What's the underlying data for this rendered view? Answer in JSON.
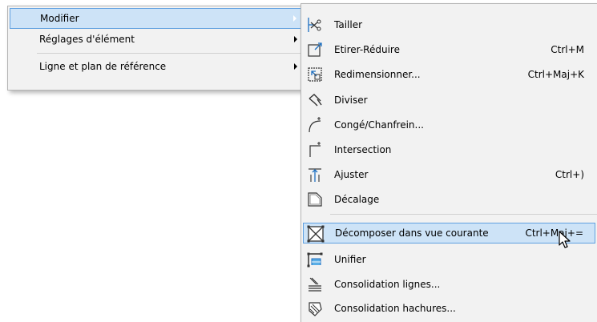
{
  "main_menu": {
    "items": [
      {
        "label": "Modifier",
        "has_submenu": true,
        "highlighted": true
      },
      {
        "label": "Réglages d'élément",
        "has_submenu": true,
        "highlighted": false
      },
      {
        "label": "Ligne et plan de référence",
        "has_submenu": true,
        "highlighted": false
      }
    ]
  },
  "sub_menu": {
    "items": [
      {
        "label": "Tailler",
        "shortcut": "",
        "icon": "trim-scissors-icon"
      },
      {
        "label": "Etirer-Réduire",
        "shortcut": "Ctrl+M",
        "icon": "stretch-icon"
      },
      {
        "label": "Redimensionner...",
        "shortcut": "Ctrl+Maj+K",
        "icon": "resize-icon"
      },
      {
        "label": "Diviser",
        "shortcut": "",
        "icon": "split-icon"
      },
      {
        "label": "Congé/Chanfrein...",
        "shortcut": "",
        "icon": "fillet-chamfer-icon"
      },
      {
        "label": "Intersection",
        "shortcut": "",
        "icon": "intersect-icon"
      },
      {
        "label": "Ajuster",
        "shortcut": "Ctrl+)",
        "icon": "adjust-icon"
      },
      {
        "label": "Décalage",
        "shortcut": "",
        "icon": "offset-icon"
      },
      {
        "label": "Décomposer dans vue courante",
        "shortcut": "Ctrl+Maj+=",
        "icon": "explode-icon",
        "highlighted": true
      },
      {
        "label": "Unifier",
        "shortcut": "",
        "icon": "unify-icon"
      },
      {
        "label": "Consolidation lignes...",
        "shortcut": "",
        "icon": "consolidate-lines-icon"
      },
      {
        "label": "Consolidation hachures...",
        "shortcut": "",
        "icon": "consolidate-fills-icon"
      }
    ]
  },
  "colors": {
    "highlight_fill": "#cde3f7",
    "highlight_border": "#5fa0e0",
    "menu_bg": "#f2f2f2"
  }
}
